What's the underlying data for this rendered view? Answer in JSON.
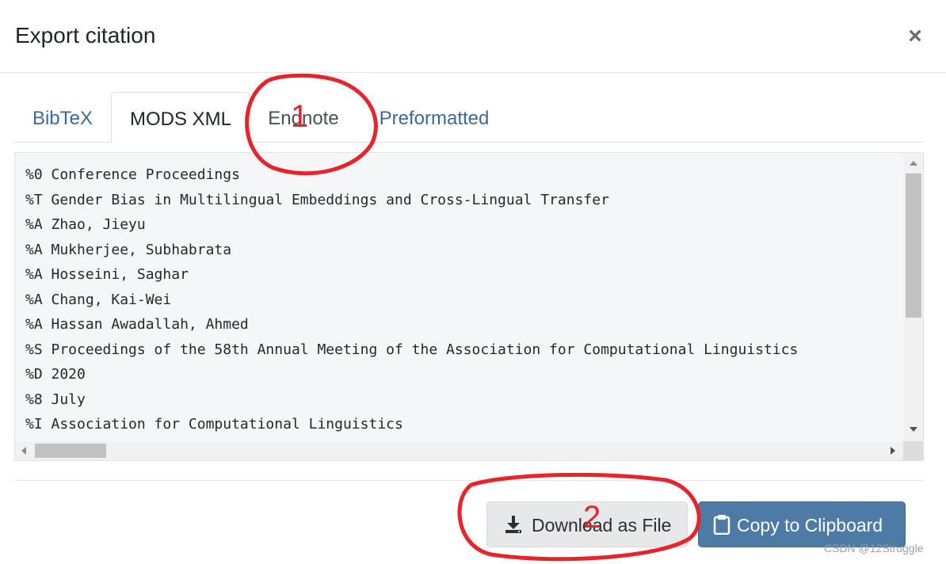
{
  "dialog": {
    "title": "Export citation",
    "close_label": "×"
  },
  "tabs": [
    {
      "label": "BibTeX",
      "active": false
    },
    {
      "label": "MODS XML",
      "active": true
    },
    {
      "label": "Endnote",
      "active": false
    },
    {
      "label": "Preformatted",
      "active": false
    }
  ],
  "citation_lines": [
    "%0 Conference Proceedings",
    "%T Gender Bias in Multilingual Embeddings and Cross-Lingual Transfer",
    "%A Zhao, Jieyu",
    "%A Mukherjee, Subhabrata",
    "%A Hosseini, Saghar",
    "%A Chang, Kai-Wei",
    "%A Hassan Awadallah, Ahmed",
    "%S Proceedings of the 58th Annual Meeting of the Association for Computational Linguistics",
    "%D 2020",
    "%8 July",
    "%I Association for Computational Linguistics"
  ],
  "footer": {
    "download_label": "Download as File",
    "download_icon": "download-icon",
    "copy_label": "Copy to Clipboard",
    "copy_icon": "clipboard-icon"
  },
  "annotations": {
    "mark_1": "1",
    "mark_2": "2",
    "color": "#e8232a"
  },
  "watermark": "CSDN @12Struggle",
  "colors": {
    "tab_link": "#3d6a96",
    "primary_button": "#4e7ba6",
    "secondary_button": "#e7e8ea"
  }
}
